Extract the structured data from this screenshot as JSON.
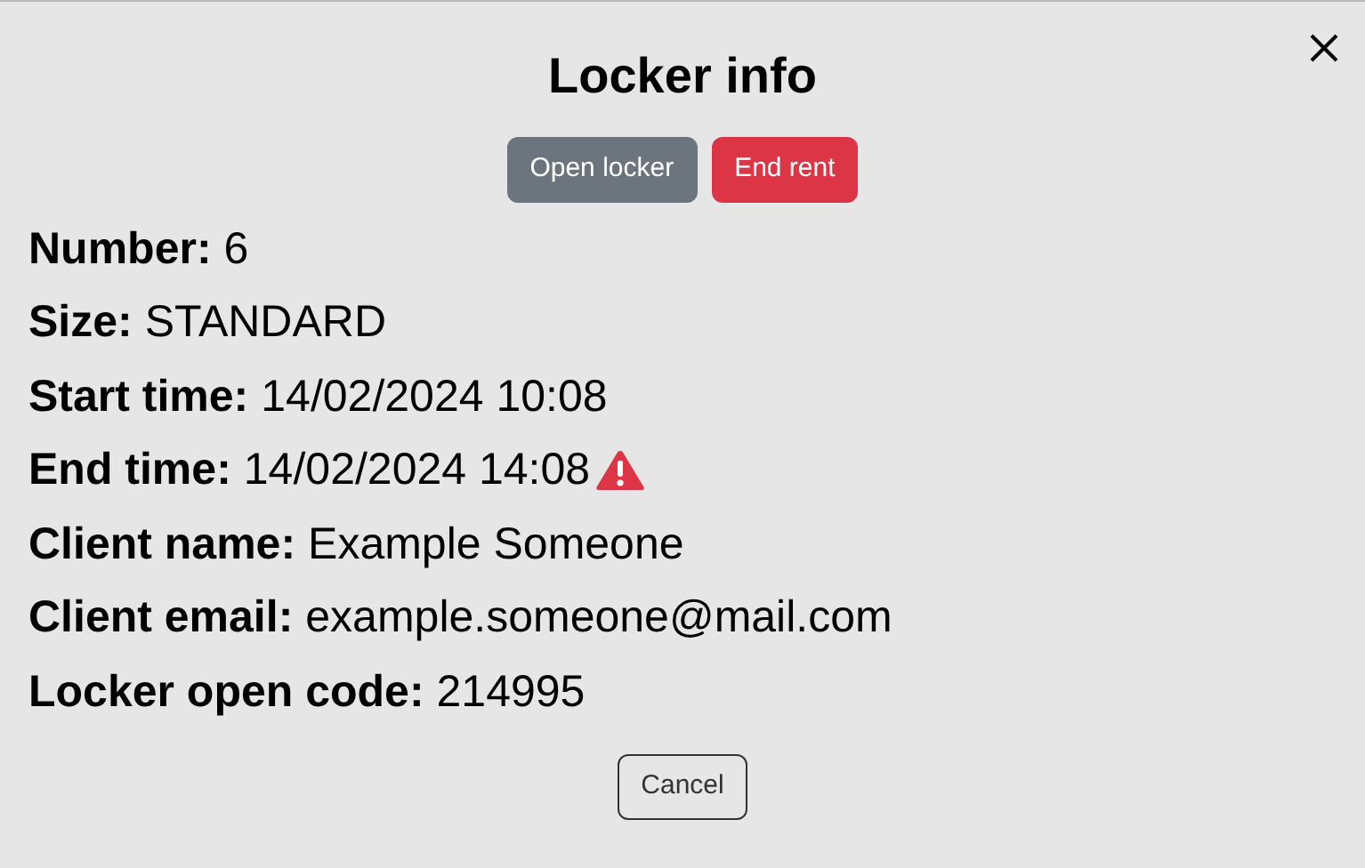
{
  "dialog": {
    "title": "Locker info",
    "actions": [
      {
        "label": "Open locker",
        "kind": "secondary"
      },
      {
        "label": "End rent",
        "kind": "danger"
      }
    ],
    "fields": [
      {
        "label": "Number:",
        "value": "6",
        "warning": false
      },
      {
        "label": "Size:",
        "value": "STANDARD",
        "warning": false
      },
      {
        "label": "Start time:",
        "value": "14/02/2024 10:08",
        "warning": false
      },
      {
        "label": "End time:",
        "value": "14/02/2024 14:08",
        "warning": true
      },
      {
        "label": "Client name:",
        "value": "Example Someone",
        "warning": false
      },
      {
        "label": "Client email:",
        "value": "example.someone@mail.com",
        "warning": false
      },
      {
        "label": "Locker open code:",
        "value": "214995",
        "warning": false
      }
    ],
    "footer_button": "Cancel"
  }
}
